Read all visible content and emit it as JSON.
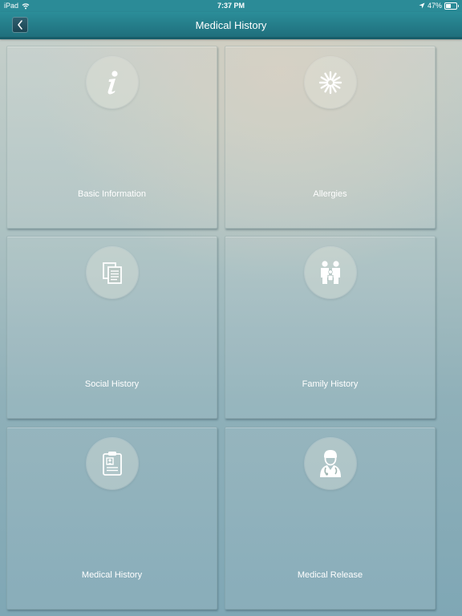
{
  "status_bar": {
    "carrier": "iPad",
    "time": "7:37 PM",
    "battery": "47%",
    "battery_level": 0.47
  },
  "nav": {
    "title": "Medical History",
    "back_icon": "chevron-left-icon"
  },
  "tiles": [
    {
      "label": "Basic Information",
      "icon": "info-icon"
    },
    {
      "label": "Allergies",
      "icon": "allergy-burst-icon"
    },
    {
      "label": "Social History",
      "icon": "documents-icon"
    },
    {
      "label": "Family History",
      "icon": "family-icon"
    },
    {
      "label": "Medical History",
      "icon": "clipboard-profile-icon"
    },
    {
      "label": "Medical Release",
      "icon": "doctor-icon"
    }
  ],
  "colors": {
    "nav_bar": "#2b8e99",
    "status_bar": "#2b8b97",
    "label_text": "#ffffff"
  }
}
